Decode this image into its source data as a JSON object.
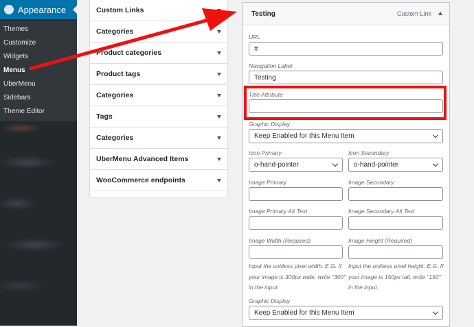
{
  "sidebar": {
    "section_label": "Appearance",
    "items": [
      "Themes",
      "Customize",
      "Widgets",
      "Menus",
      "UberMenu",
      "Sidebars",
      "Theme Editor"
    ]
  },
  "accordion": {
    "items": [
      "Custom Links",
      "Categories",
      "Product categories",
      "Product tags",
      "Categories",
      "Tags",
      "Categories",
      "UberMenu Advanced Items",
      "WooCommerce endpoints"
    ]
  },
  "menu_item": {
    "title": "Testing",
    "type": "Custom Link",
    "url_label": "URL",
    "url_value": "#",
    "nav_label": "Navigation Label",
    "nav_value": "Testing",
    "title_attr_label": "Title Attribute",
    "title_attr_value": "",
    "graphic_display_label": "Graphic Display",
    "graphic_display_value": "Keep Enabled for this Menu Item",
    "icon_primary_label": "Icon Primary",
    "icon_primary_value": "o-hand-pointer",
    "icon_secondary_label": "Icon Secondary",
    "icon_secondary_value": "o-hand-pointer",
    "image_primary_label": "Image Primary",
    "image_secondary_label": "Image Secondary",
    "image_primary_alt_label": "Image Primary Alt Text",
    "image_secondary_alt_label": "Image Secondary Alt Text",
    "image_width_label": "Image Width (Required)",
    "image_height_label": "Image Height (Required)",
    "image_width_desc": "Input the unitless pixel width. E.G. If your image is 300px wide, write \"300\" in the input.",
    "image_height_desc": "Input the unitless pixel height. E.G. If your image is 150px tall, write \"150\" in the input.",
    "graphic_display_label_2": "Graphic Display",
    "graphic_display_value_2": "Keep Enabled for this Menu Item"
  },
  "annotations": {
    "highlight_color": "#ee1111",
    "arrow_color": "#ee1111"
  }
}
